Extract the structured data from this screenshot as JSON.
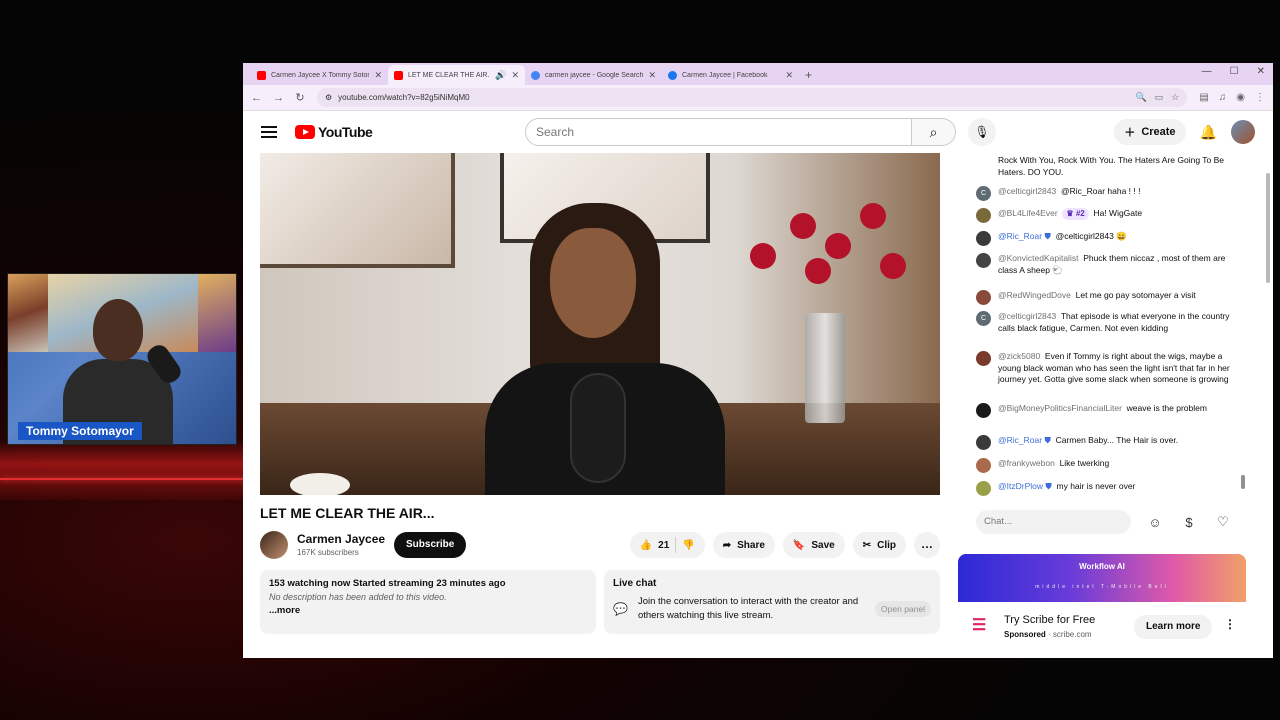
{
  "stream": {
    "presenter_name": "Tommy Sotomayor"
  },
  "browser": {
    "tabs": [
      {
        "title": "Carmen Jaycee X Tommy Sotom",
        "favicon_color": "#ff0000",
        "active": false
      },
      {
        "title": "LET ME CLEAR THE AIR... -",
        "favicon_color": "#ff0000",
        "active": true
      },
      {
        "title": "carmen jaycee - Google Search",
        "favicon_color": "#4285f4",
        "active": false
      },
      {
        "title": "Carmen Jaycee | Facebook",
        "favicon_color": "#1877f2",
        "active": false
      }
    ],
    "url": "youtube.com/watch?v=82g5iNiMqM0"
  },
  "youtube": {
    "logo_text": "YouTube",
    "search_placeholder": "Search",
    "create_label": "Create",
    "video": {
      "title": "LET ME CLEAR THE AIR...",
      "channel_name": "Carmen Jaycee",
      "subscribers": "167K subscribers",
      "subscribe_label": "Subscribe",
      "likes": "21",
      "share_label": "Share",
      "save_label": "Save",
      "clip_label": "Clip",
      "more_actions": "…"
    },
    "description": {
      "stats": "153 watching now  Started streaming 23 minutes ago",
      "text": "No description has been added to this video.",
      "more": "...more"
    },
    "live_chat_card": {
      "title": "Live chat",
      "text": "Join the conversation to interact with the creator and others watching this live stream.",
      "open_label": "Open panel"
    }
  },
  "chat": {
    "messages": [
      {
        "author": "",
        "text": "Rock With You, Rock With You. The Haters Are Going To Be Haters. DO YOU.",
        "avatar_color": "",
        "avatar_letter": ""
      },
      {
        "author": "@celticgirl2843",
        "text": "@Ric_Roar haha ! ! !",
        "avatar_color": "#5f6b73",
        "avatar_letter": "C"
      },
      {
        "author": "@BL4Life4Ever",
        "badge": "#2",
        "text": "Ha! WigGate",
        "avatar_color": "#7a6a3a",
        "avatar_letter": ""
      },
      {
        "author": "@Ric_Roar",
        "text": "@celticgirl2843 😄",
        "avatar_color": "#3a3a3a",
        "avatar_letter": "",
        "moderator": true
      },
      {
        "author": "@KonvictedKapitalist",
        "text": "Phuck them niccaz , most of them are class A sheep 🐑",
        "avatar_color": "#444",
        "avatar_letter": ""
      },
      {
        "author": "@RedWingedDove",
        "text": "Let me go pay sotomayer a visit",
        "avatar_color": "#8a4a3a",
        "avatar_letter": ""
      },
      {
        "author": "@celticgirl2843",
        "text": "That episode is what everyone in the country calls black fatigue, Carmen. Not even kidding",
        "avatar_color": "#5f6b73",
        "avatar_letter": "C"
      },
      {
        "author": "@zick5080",
        "text": "Even if Tommy is right about the wigs, maybe a young black woman who has seen the light isn't that far in her journey yet. Gotta give some slack when someone is growing",
        "avatar_color": "#7a3a2a",
        "avatar_letter": ""
      },
      {
        "author": "@BigMoneyPoliticsFinancialLiter",
        "text": "weave is the problem",
        "avatar_color": "#1a1a1a",
        "avatar_letter": ""
      },
      {
        "author": "@Ric_Roar",
        "text": "Carmen Baby... The Hair is over.",
        "avatar_color": "#3a3a3a",
        "avatar_letter": "",
        "moderator": true
      },
      {
        "author": "@frankywebon",
        "text": "Like twerking",
        "avatar_color": "#a86a4a",
        "avatar_letter": ""
      },
      {
        "author": "@ItzDrPlow",
        "text": "my hair is never over",
        "avatar_color": "#9aa04a",
        "avatar_letter": "",
        "moderator": true
      }
    ],
    "input_placeholder": "Chat..."
  },
  "ad": {
    "banner_title": "Workflow AI",
    "banner_brands": "middle   intel   T-Mobile   Bell",
    "title": "Try Scribe for Free",
    "sponsored": "Sponsored",
    "domain": "scribe.com",
    "cta": "Learn more"
  }
}
